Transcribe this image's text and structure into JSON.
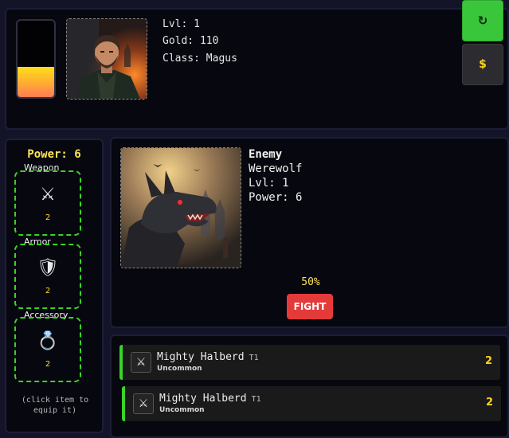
{
  "hero": {
    "health_fraction": 0.4,
    "level": "Lvl: 1",
    "gold": "Gold: 110",
    "class": "Class: Magus",
    "portrait": "warrior-portrait"
  },
  "actions": {
    "refresh_icon": "↻",
    "gold_icon": "$"
  },
  "equipment": {
    "power": "Power: 6",
    "slots": [
      {
        "label": "Weapon",
        "icon": "⚔",
        "icon_name": "crossed-swords-icon",
        "count": "2"
      },
      {
        "label": "Armor",
        "icon": "🛡",
        "icon_name": "shield-icon",
        "count": "2"
      },
      {
        "label": "Accessory",
        "icon": "💍",
        "icon_name": "ring-icon",
        "count": "2"
      }
    ],
    "hint": "(click item to equip it)"
  },
  "enemy": {
    "heading": "Enemy",
    "name": "Werewolf",
    "level": "Lvl: 1",
    "power": "Power: 6",
    "portrait": "werewolf-portrait",
    "win_chance": "50%",
    "fight_label": "FIGHT"
  },
  "inventory": [
    {
      "name": "Mighty Halberd",
      "tier": "T1",
      "rarity": "Uncommon",
      "power": "2",
      "icon": "⚔",
      "icon_name": "crossed-swords-icon"
    },
    {
      "name": "Mighty Halberd",
      "tier": "T1",
      "rarity": "Uncommon",
      "power": "2",
      "icon": "⚔",
      "icon_name": "crossed-swords-icon"
    }
  ],
  "colors": {
    "accent_green": "#39d323",
    "fight_red": "#e53a3a",
    "gold_yellow": "#ffd21f"
  }
}
